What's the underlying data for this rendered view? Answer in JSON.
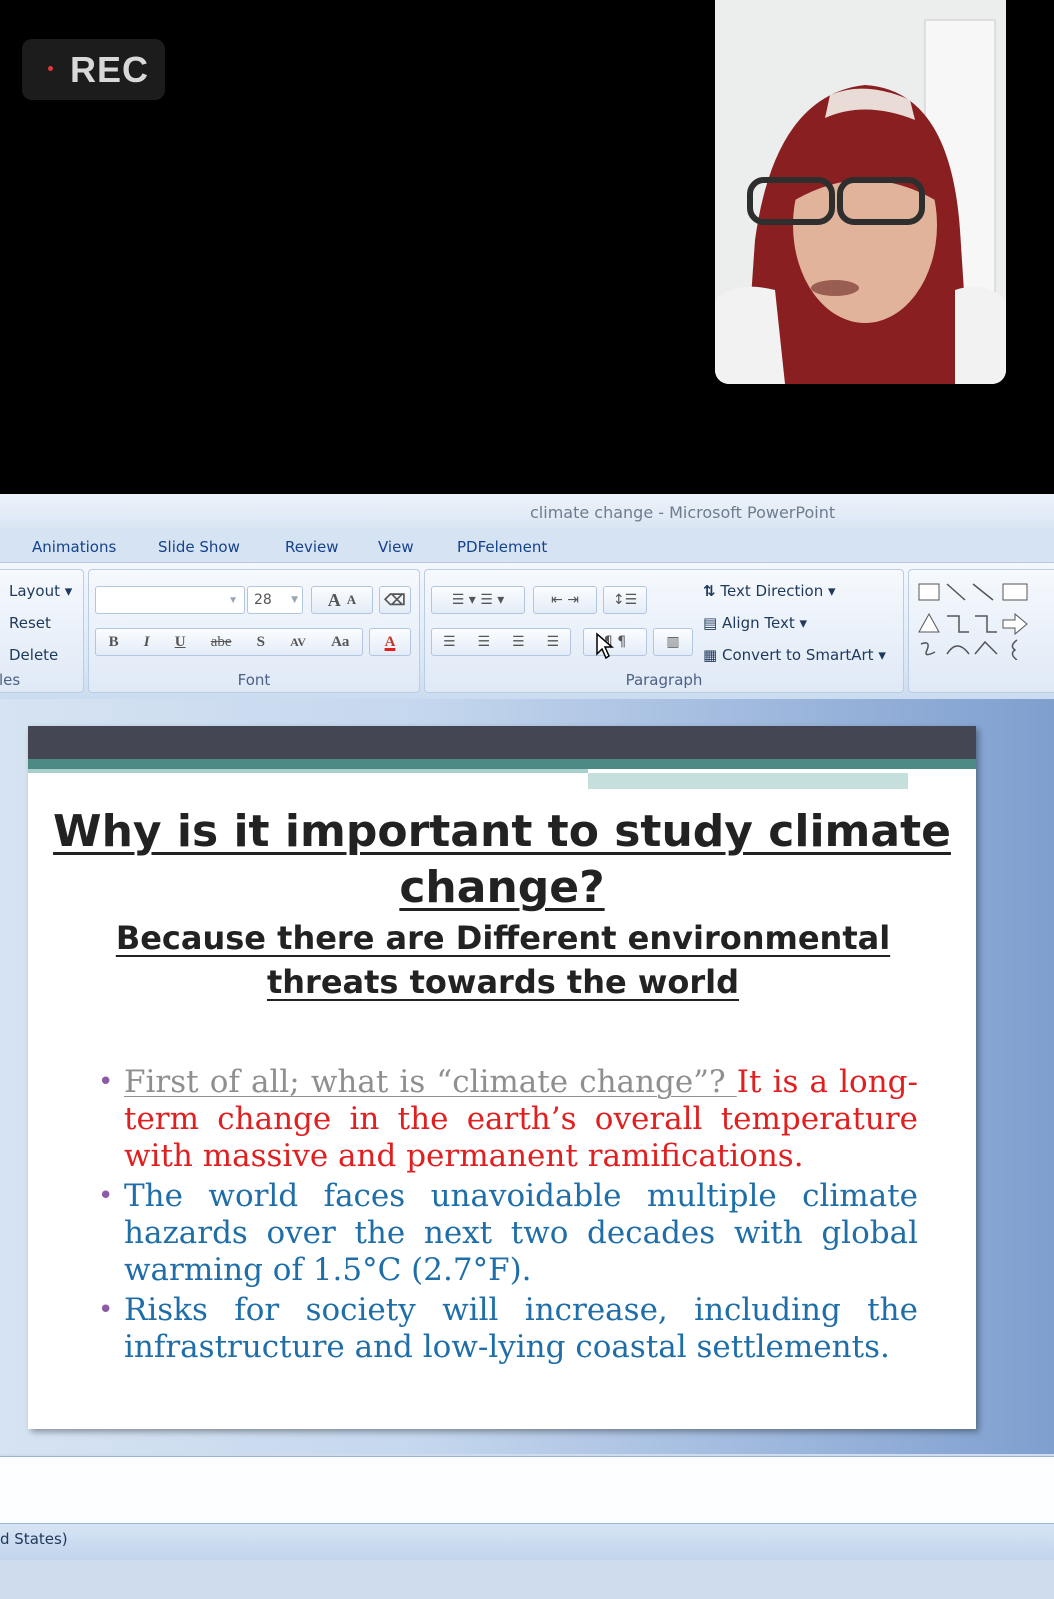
{
  "recording": {
    "label": "REC",
    "dot_color": "#e53935"
  },
  "webcam": {
    "description_icon": "participant-video"
  },
  "window": {
    "title": "climate change - Microsoft PowerPoint"
  },
  "ribbon_tabs": [
    "Animations",
    "Slide Show",
    "Review",
    "View",
    "PDFelement"
  ],
  "slides_group": {
    "layout": "Layout",
    "reset": "Reset",
    "delete": "Delete",
    "label": "les"
  },
  "font_group": {
    "font_size": "28",
    "label": "Font",
    "grow": "A",
    "shrink": "A",
    "bold": "B",
    "italic": "I",
    "underline": "U",
    "strike": "abe",
    "shadow": "S",
    "spacing": "AV",
    "case": "Aa",
    "color": "A"
  },
  "paragraph_group": {
    "label": "Paragraph",
    "text_direction": "Text Direction",
    "align_text": "Align Text",
    "convert_smartart": "Convert to SmartArt"
  },
  "slide": {
    "title": "Why is it important to study climate change?",
    "subtitle": "Because there are Different environmental threats towards the world",
    "bullet1_question": "First of all; what is “climate change”? ",
    "bullet1_answer": "It is a long-term change in the earth’s overall temperature with massive and permanent ramifications.",
    "bullet2": "The world faces unavoidable multiple climate hazards over the next two decades with global warming of 1.5°C (2.7°F).",
    "bullet3": " Risks for society will increase, including the infrastructure and low-lying coastal settlements."
  },
  "status": {
    "language": "d States)"
  },
  "colors": {
    "accent_red": "#e02020",
    "accent_blue": "#1f6ea8",
    "ribbon_text": "#1e395b"
  }
}
